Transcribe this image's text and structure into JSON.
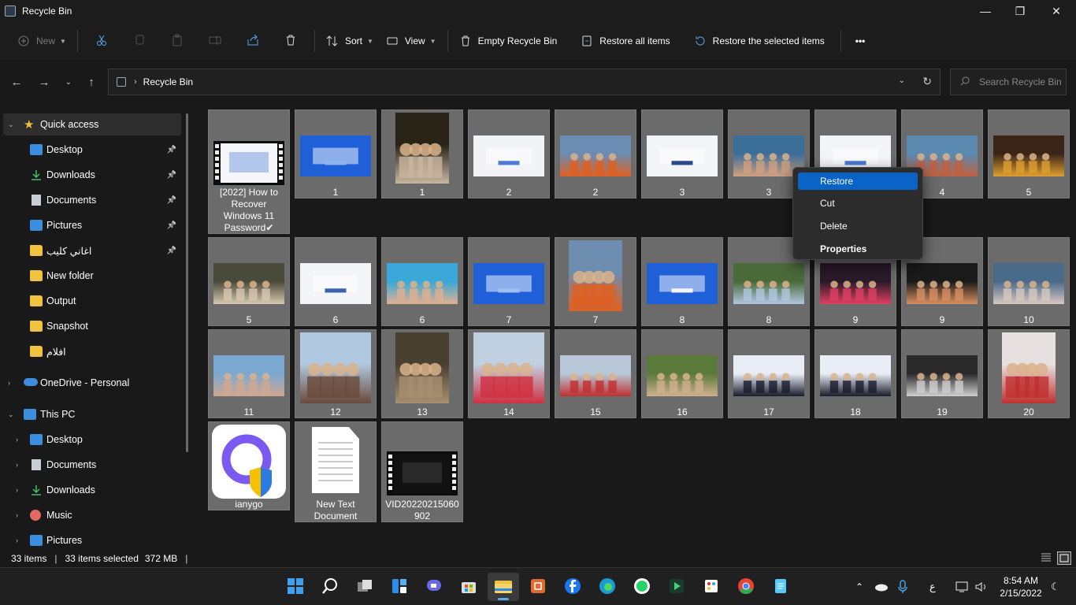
{
  "window": {
    "title": "Recycle Bin",
    "minimize": "—",
    "maximize": "❐",
    "close": "✕"
  },
  "toolbar": {
    "new_label": "New",
    "sort_label": "Sort",
    "view_label": "View",
    "empty_label": "Empty Recycle Bin",
    "restore_all_label": "Restore all items",
    "restore_selected_label": "Restore the selected items",
    "more_label": "•••"
  },
  "address": {
    "crumb": "Recycle Bin",
    "search_placeholder": "Search Recycle Bin"
  },
  "sidebar": {
    "quick_access": "Quick access",
    "items": [
      {
        "label": "Desktop",
        "icon": "desktop-icon"
      },
      {
        "label": "Downloads",
        "icon": "download-icon"
      },
      {
        "label": "Documents",
        "icon": "document-icon"
      },
      {
        "label": "Pictures",
        "icon": "pictures-icon"
      },
      {
        "label": "اغاني كليب",
        "icon": "folder-icon"
      },
      {
        "label": "New folder",
        "icon": "folder-icon"
      },
      {
        "label": "Output",
        "icon": "folder-icon"
      },
      {
        "label": "Snapshot",
        "icon": "folder-icon"
      },
      {
        "label": "افلام",
        "icon": "folder-icon"
      }
    ],
    "onedrive": "OneDrive - Personal",
    "this_pc": "This PC",
    "pc_items": [
      {
        "label": "Desktop",
        "icon": "desktop-icon"
      },
      {
        "label": "Documents",
        "icon": "document-icon"
      },
      {
        "label": "Downloads",
        "icon": "download-icon"
      },
      {
        "label": "Music",
        "icon": "music-icon"
      },
      {
        "label": "Pictures",
        "icon": "pictures-icon"
      }
    ]
  },
  "files": [
    {
      "name": "[2022] How to Recover Windows 11 Password✔",
      "kind": "video",
      "colors": [
        "#f4f6fa",
        "#3a6fd0"
      ]
    },
    {
      "name": "1",
      "kind": "image",
      "colors": [
        "#1f5fd8",
        "#8fb4f0"
      ]
    },
    {
      "name": "1",
      "kind": "photo",
      "colors": [
        "#2a2418",
        "#c8b7a0"
      ]
    },
    {
      "name": "2",
      "kind": "image",
      "colors": [
        "#f2f3f6",
        "#4d7ad6"
      ]
    },
    {
      "name": "2",
      "kind": "photo",
      "colors": [
        "#6b8db3",
        "#e06020"
      ]
    },
    {
      "name": "3",
      "kind": "image",
      "colors": [
        "#f3f4f7",
        "#2b4a8a"
      ]
    },
    {
      "name": "3",
      "kind": "photo",
      "colors": [
        "#3c6e9a",
        "#d0a080"
      ]
    },
    {
      "name": "",
      "kind": "image",
      "colors": [
        "#f3f4f7",
        "#4d7ad6"
      ]
    },
    {
      "name": "4",
      "kind": "photo",
      "colors": [
        "#5a8ab0",
        "#c06040"
      ]
    },
    {
      "name": "5",
      "kind": "photo",
      "colors": [
        "#3a2418",
        "#e0a030"
      ]
    },
    {
      "name": "5",
      "kind": "photo",
      "colors": [
        "#4a4a3a",
        "#d8c8b0"
      ]
    },
    {
      "name": "6",
      "kind": "image",
      "colors": [
        "#f3f4f7",
        "#3a64b0"
      ]
    },
    {
      "name": "6",
      "kind": "photo",
      "colors": [
        "#3aa8d8",
        "#e0b090"
      ]
    },
    {
      "name": "7",
      "kind": "image",
      "colors": [
        "#1f5fd8",
        "#9fc0f0"
      ]
    },
    {
      "name": "7",
      "kind": "photo",
      "colors": [
        "#6d8db0",
        "#e06020"
      ]
    },
    {
      "name": "8",
      "kind": "image",
      "colors": [
        "#1f5fd8",
        "#f5f5f5"
      ]
    },
    {
      "name": "8",
      "kind": "photo",
      "colors": [
        "#4a6a3a",
        "#b0c8e0"
      ]
    },
    {
      "name": "9",
      "kind": "photo",
      "colors": [
        "#2a1a2a",
        "#e04060"
      ]
    },
    {
      "name": "9",
      "kind": "photo",
      "colors": [
        "#1a1a1a",
        "#d89060"
      ]
    },
    {
      "name": "10",
      "kind": "photo",
      "colors": [
        "#4a6a8a",
        "#d8c8c0"
      ]
    },
    {
      "name": "11",
      "kind": "photo",
      "colors": [
        "#7aa8d0",
        "#d0a890"
      ]
    },
    {
      "name": "12",
      "kind": "photo",
      "colors": [
        "#b0c8e0",
        "#6a4a3a"
      ]
    },
    {
      "name": "13",
      "kind": "photo",
      "colors": [
        "#4a4030",
        "#a89070"
      ]
    },
    {
      "name": "14",
      "kind": "photo",
      "colors": [
        "#c0d0e0",
        "#d03040"
      ]
    },
    {
      "name": "15",
      "kind": "photo",
      "colors": [
        "#b8c8d8",
        "#c03030"
      ]
    },
    {
      "name": "16",
      "kind": "photo",
      "colors": [
        "#5a7a3a",
        "#d0b090"
      ]
    },
    {
      "name": "17",
      "kind": "photo",
      "colors": [
        "#e8ecf4",
        "#1a1a2a"
      ]
    },
    {
      "name": "18",
      "kind": "photo",
      "colors": [
        "#e8ecf4",
        "#1a1a2a"
      ]
    },
    {
      "name": "19",
      "kind": "photo",
      "colors": [
        "#2a2a2a",
        "#d0d0d0"
      ]
    },
    {
      "name": "20",
      "kind": "photo",
      "colors": [
        "#e8e0e0",
        "#c03030"
      ]
    },
    {
      "name": "ianygo",
      "kind": "app",
      "colors": [
        "#ffffff",
        "#7a5af0"
      ]
    },
    {
      "name": "New Text Document",
      "kind": "text",
      "colors": [
        "#ffffff",
        "#bbbbbb"
      ]
    },
    {
      "name": "VID20220215060902",
      "kind": "video",
      "colors": [
        "#111111",
        "#555555"
      ]
    }
  ],
  "context_menu": {
    "items": [
      "Restore",
      "Cut",
      "Delete",
      "Properties"
    ]
  },
  "status": {
    "count": "33 items",
    "selected": "33 items selected",
    "size": "372 MB"
  },
  "taskbar": {
    "apps": [
      "windows-start-icon",
      "search-icon",
      "task-view-icon",
      "widgets-icon",
      "chat-icon",
      "store-icon",
      "file-explorer-icon",
      "snip-icon",
      "facebook-icon",
      "edge-icon",
      "whatsapp-icon",
      "video-editor-icon",
      "paint-icon",
      "chrome-icon",
      "notepad-icon"
    ],
    "lang": "ع",
    "time": "8:54 AM",
    "date": "2/15/2022"
  },
  "colors": {
    "accent": "#0a64c8",
    "tile": "#6b6b6b",
    "bg": "#191919"
  }
}
